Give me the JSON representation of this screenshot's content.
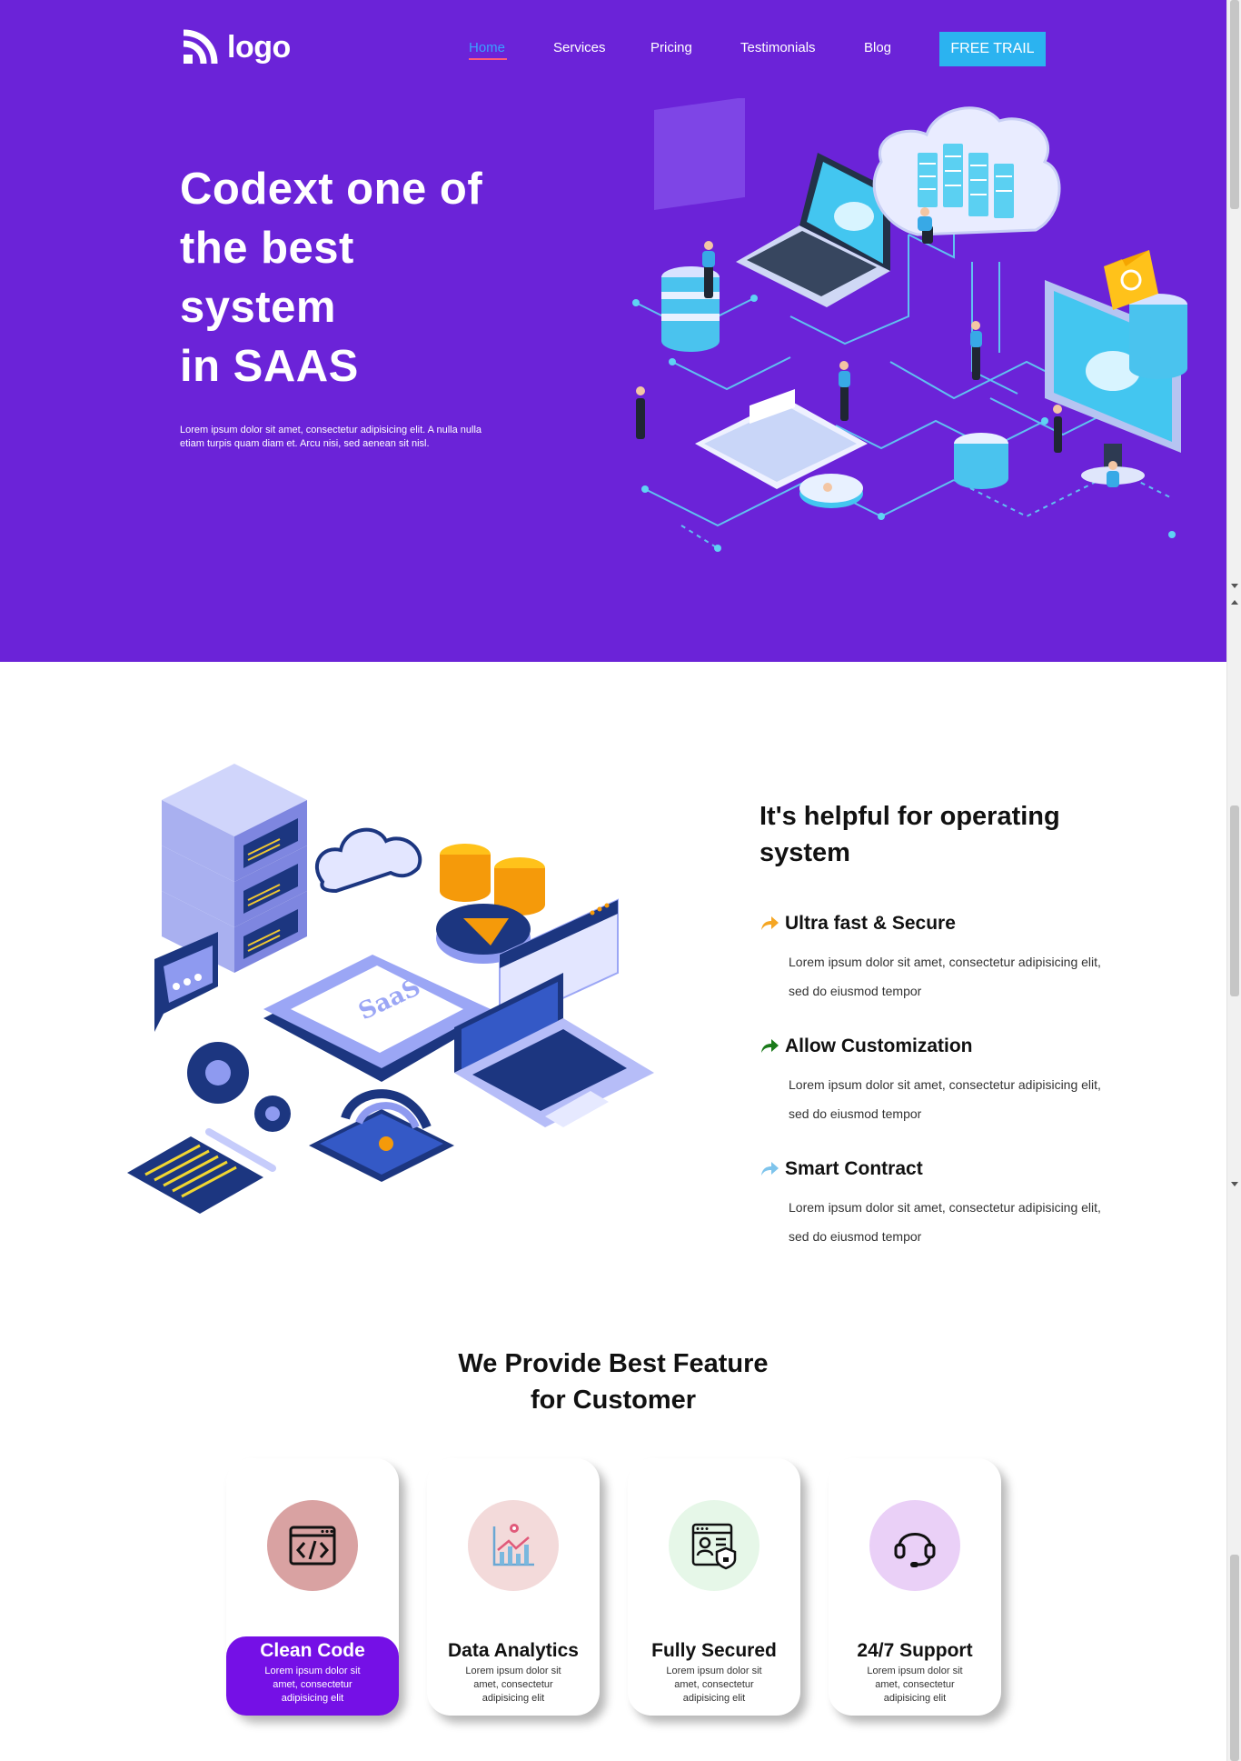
{
  "brand": {
    "logo_text": "logo"
  },
  "nav": {
    "links": [
      "Home",
      "Services",
      "Pricing",
      "Testimonials",
      "Blog"
    ],
    "cta": "FREE TRAIL"
  },
  "hero": {
    "title": "Codext one of\nthe best\nsystem\nin SAAS",
    "description": "Lorem ipsum dolor sit amet, consectetur adipisicing elit. A nulla nulla etiam turpis quam diam et. Arcu nisi, sed aenean sit nisl."
  },
  "section2": {
    "title": "It's helpful for operating system",
    "features": [
      {
        "title": "Ultra fast & Secure",
        "desc": "Lorem ipsum dolor sit amet, consectetur adipisicing elit, sed do eiusmod tempor",
        "arrow_color": "#f5a623",
        "icon": "arrow-right-icon"
      },
      {
        "title": "Allow Customization",
        "desc": "Lorem ipsum dolor sit amet, consectetur adipisicing elit, sed do eiusmod tempor",
        "arrow_color": "#1a7a1a",
        "icon": "arrow-right-icon"
      },
      {
        "title": "Smart Contract",
        "desc": "Lorem ipsum dolor sit amet, consectetur adipisicing elit, sed do eiusmod tempor",
        "arrow_color": "#7ec4ec",
        "icon": "arrow-right-icon"
      }
    ]
  },
  "section3": {
    "title": "We Provide Best Feature\nfor Customer",
    "cards": [
      {
        "title": "Clean Code",
        "desc": "Lorem ipsum dolor sit amet, consectetur adipisicing elit",
        "icon": "code-window-icon",
        "bg": "#d9a2a2"
      },
      {
        "title": "Data Analytics",
        "desc": "Lorem ipsum dolor sit amet, consectetur adipisicing elit",
        "icon": "analytics-chart-icon",
        "bg": "#f3dada"
      },
      {
        "title": "Fully Secured",
        "desc": "Lorem ipsum dolor sit amet, consectetur adipisicing elit",
        "icon": "secure-profile-icon",
        "bg": "#e6f7e8"
      },
      {
        "title": "24/7 Support",
        "desc": "Lorem ipsum dolor sit amet, consectetur adipisicing elit",
        "icon": "headset-icon",
        "bg": "#ead0f7"
      }
    ]
  },
  "colors": {
    "hero_bg": "#6b23d8",
    "cta_bg": "#2bb3f0",
    "active_link": "#3aa0ff",
    "highlight_card": "#7510e6"
  }
}
